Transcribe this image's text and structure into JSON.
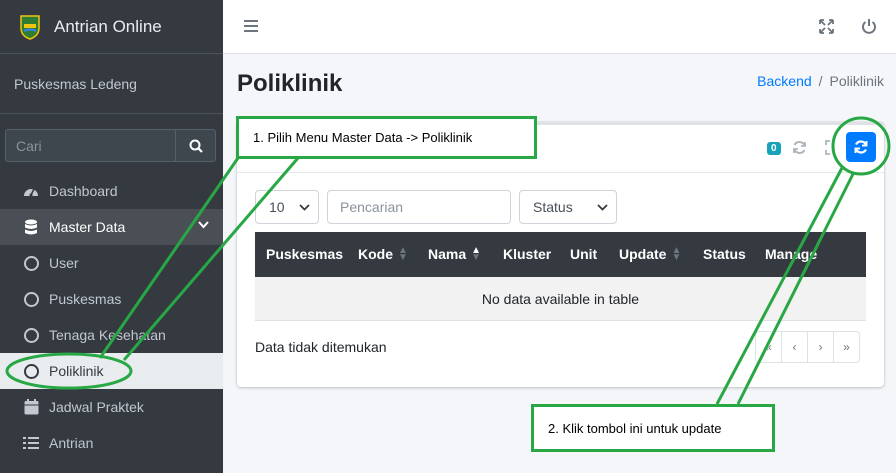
{
  "brand": {
    "title": "Antrian Online"
  },
  "user": {
    "name": "Puskesmas Ledeng"
  },
  "sidebar": {
    "search_placeholder": "Cari",
    "items": [
      {
        "label": "Dashboard",
        "icon": "tachometer-icon"
      },
      {
        "label": "Master Data",
        "icon": "database-icon"
      },
      {
        "label": "User",
        "icon": "circle-icon"
      },
      {
        "label": "Puskesmas",
        "icon": "circle-icon"
      },
      {
        "label": "Tenaga Kesehatan",
        "icon": "circle-icon"
      },
      {
        "label": "Poliklinik",
        "icon": "circle-icon"
      },
      {
        "label": "Jadwal Praktek",
        "icon": "calendar-icon"
      },
      {
        "label": "Antrian",
        "icon": "list-icon"
      }
    ]
  },
  "page": {
    "title": "Poliklinik"
  },
  "breadcrumb": {
    "home": "Backend",
    "separator": "/",
    "current": "Poliklinik"
  },
  "card": {
    "badge_count": "0",
    "filters": {
      "length_value": "10",
      "search_placeholder": "Pencarian",
      "status_value": "Status"
    },
    "table": {
      "headers": [
        "Puskesmas",
        "Kode",
        "Nama",
        "Kluster",
        "Unit",
        "Update",
        "Status",
        "Manage"
      ],
      "empty_text": "No data available in table"
    },
    "info_text": "Data tidak ditemukan",
    "pagination": [
      "«",
      "‹",
      "›",
      "»"
    ]
  },
  "annotations": {
    "note1": "1. Pilih Menu Master Data -> Poliklinik",
    "note2": "2. Klik tombol ini untuk update"
  },
  "colors": {
    "sidebar": "#343a40",
    "accent": "#007bff",
    "annotation": "#28a745",
    "badge": "#17a2b8"
  }
}
